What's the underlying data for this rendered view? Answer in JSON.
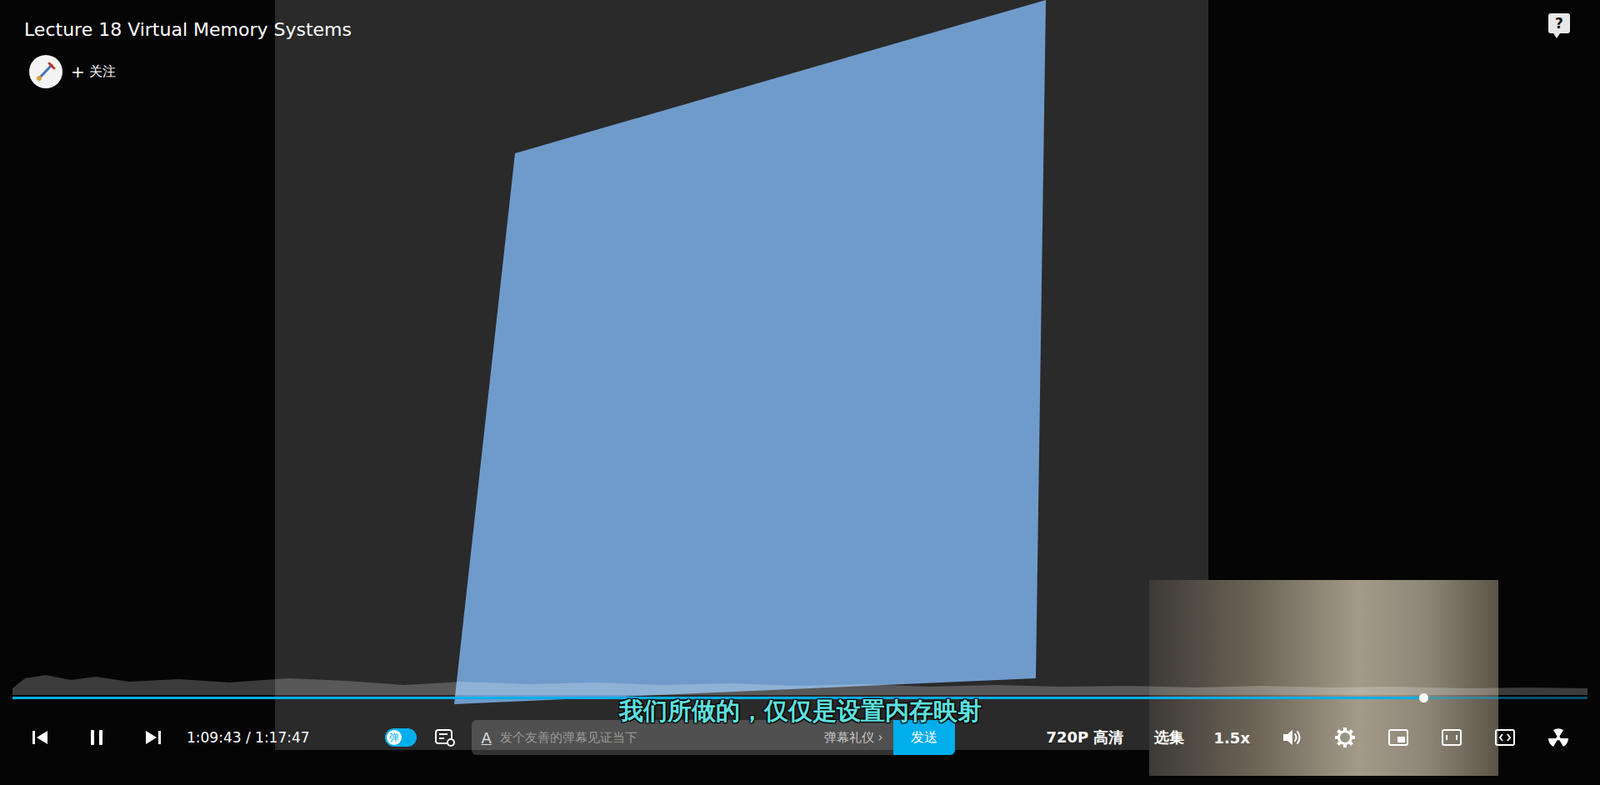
{
  "window": {
    "title": "Lecture 18 Virtual Memory Systems"
  },
  "uploader": {
    "follow_icon": "+",
    "follow": "关注"
  },
  "help": "?",
  "subtitle": "我们所做的，仅仅是设置内存映射",
  "progress": {
    "level": 0.896
  },
  "controls": {
    "time": "1:09:43 / 1:17:47",
    "playing": true
  },
  "danmaku": {
    "toggle_label": "弹",
    "on": true,
    "input_icon": "A",
    "placeholder": "发个友善的弹幕见证当下",
    "etiquette": "弹幕礼仪",
    "etiquette_icon": "›",
    "send": "发送"
  },
  "menu": {
    "quality": "720P 高清",
    "episodes": "选集",
    "speed": "1.5x"
  }
}
